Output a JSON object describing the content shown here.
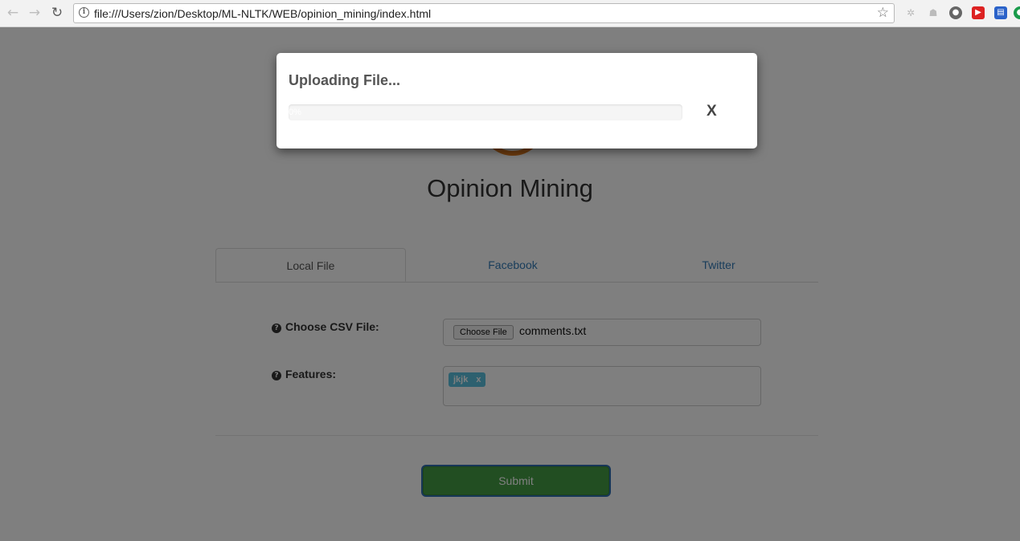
{
  "browser": {
    "url": "file:///Users/zion/Desktop/ML-NLTK/WEB/opinion_mining/index.html",
    "back_icon": "back-arrow-icon",
    "forward_icon": "forward-arrow-icon",
    "reload_icon": "reload-icon",
    "info_icon": "info-icon",
    "star_icon": "bookmark-star-icon",
    "extensions": [
      "extension-icon-1",
      "extension-icon-2",
      "extension-icon-3",
      "youtube-icon",
      "save-icon",
      "green-extension-icon"
    ]
  },
  "page": {
    "title": "Opinion Mining",
    "tabs": [
      {
        "label": "Local File",
        "active": true
      },
      {
        "label": "Facebook",
        "active": false
      },
      {
        "label": "Twitter",
        "active": false
      }
    ],
    "form": {
      "csv_label": "Choose CSV File:",
      "choose_file_button": "Choose File",
      "file_name": "comments.txt",
      "features_label": "Features:",
      "feature_tags": [
        {
          "text": "jkjk",
          "remove": "x"
        }
      ]
    },
    "submit_label": "Submit"
  },
  "modal": {
    "title": "Uploading File...",
    "progress_percent": 0,
    "progress_text": "0%",
    "close_label": "X"
  },
  "colors": {
    "accent": "#337ab7",
    "tag": "#5bc0de",
    "submit": "#449d44",
    "logo": "#e07b1f"
  }
}
